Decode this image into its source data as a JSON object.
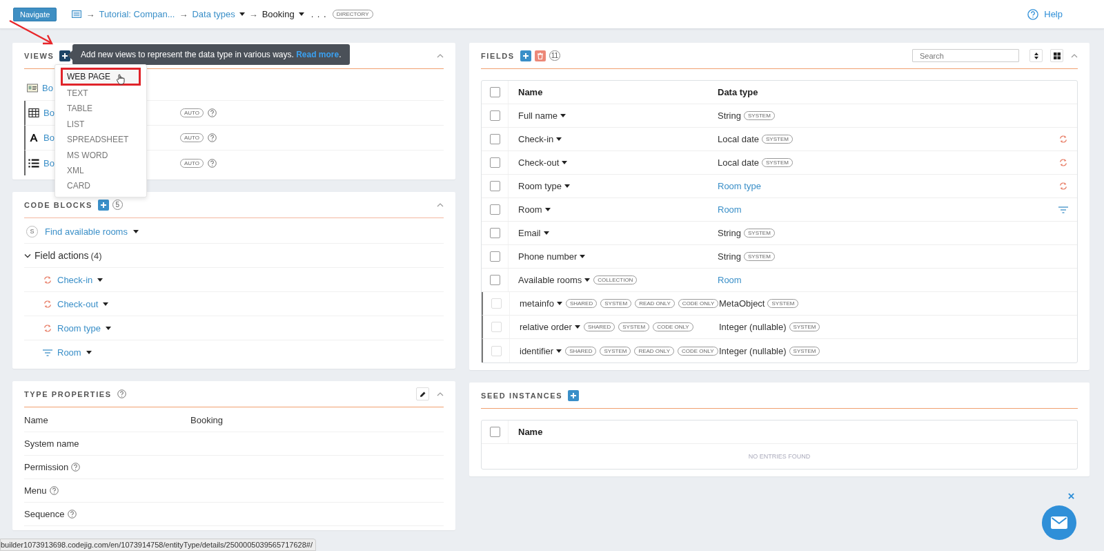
{
  "topbar": {
    "navigate": "Navigate",
    "breadcrumb": [
      {
        "sep": "→",
        "text": "Tutorial: Compan...",
        "link": true,
        "caret": false
      },
      {
        "sep": "→",
        "text": "Data types",
        "link": true,
        "caret": true
      },
      {
        "sep": "→",
        "text": "Booking",
        "link": false,
        "caret": true
      }
    ],
    "ellipsis": ". . .",
    "badge": "DIRECTORY",
    "help": "Help"
  },
  "views": {
    "title": "VIEWS",
    "tooltip": {
      "text": "Add new views to represent the data type in various ways.",
      "link": "Read more",
      "end": "."
    },
    "menu": [
      {
        "label": "WEB PAGE",
        "selected": true
      },
      {
        "label": "TEXT",
        "selected": false
      },
      {
        "label": "TABLE",
        "selected": false
      },
      {
        "label": "LIST",
        "selected": false
      },
      {
        "label": "SPREADSHEET",
        "selected": false
      },
      {
        "label": "MS WORD",
        "selected": false
      },
      {
        "label": "XML",
        "selected": false
      },
      {
        "label": "CARD",
        "selected": false
      }
    ],
    "rows": [
      {
        "kind": "card",
        "name": "Bo",
        "chips": [],
        "help": false,
        "accent": false
      },
      {
        "kind": "table",
        "name": "Bo",
        "chips": [
          "AUTO"
        ],
        "help": true,
        "accent": true
      },
      {
        "kind": "text",
        "name": "Bo",
        "chips": [
          "AUTO"
        ],
        "help": true,
        "accent": true
      },
      {
        "kind": "list",
        "name": "Bo",
        "chips": [
          "AUTO"
        ],
        "help": true,
        "accent": true
      }
    ]
  },
  "code_blocks": {
    "title": "CODE BLOCKS",
    "count": "5",
    "items": [
      {
        "kind": "item",
        "badge": "S",
        "label": "Find available rooms"
      },
      {
        "kind": "group",
        "label": "Field actions",
        "count": "(4)",
        "expanded": true,
        "children": [
          {
            "kind": "sync",
            "label": "Check-in"
          },
          {
            "kind": "sync",
            "label": "Check-out"
          },
          {
            "kind": "sync",
            "label": "Room type"
          },
          {
            "kind": "filter",
            "label": "Room"
          }
        ]
      }
    ]
  },
  "type_properties": {
    "title": "TYPE PROPERTIES",
    "rows": [
      {
        "label": "Name",
        "value": "Booking",
        "help": false
      },
      {
        "label": "System name",
        "help": false
      },
      {
        "label": "Permission",
        "help": true
      },
      {
        "label": "Menu",
        "help": true
      },
      {
        "label": "Sequence",
        "help": true
      }
    ]
  },
  "fields": {
    "title": "FIELDS",
    "count": "11",
    "search": {
      "placeholder": "Search"
    },
    "select_all": {
      "checked": false
    },
    "columns": [
      "Name",
      "Data type"
    ],
    "rows": [
      {
        "kind": "plain",
        "name": "Full name",
        "chips": [],
        "type": "String",
        "type_link": false,
        "type_chips": [
          "SYSTEM"
        ],
        "system": false
      },
      {
        "kind": "sync",
        "name": "Check-in",
        "chips": [],
        "type": "Local date",
        "type_link": false,
        "type_chips": [
          "SYSTEM"
        ],
        "system": false
      },
      {
        "kind": "sync",
        "name": "Check-out",
        "chips": [],
        "type": "Local date",
        "type_link": false,
        "type_chips": [
          "SYSTEM"
        ],
        "system": false
      },
      {
        "kind": "sync",
        "name": "Room type",
        "chips": [],
        "type": "Room type",
        "type_link": true,
        "type_chips": [],
        "system": false
      },
      {
        "kind": "filter",
        "name": "Room",
        "chips": [],
        "type": "Room",
        "type_link": true,
        "type_chips": [],
        "system": false
      },
      {
        "kind": "plain",
        "name": "Email",
        "chips": [],
        "type": "String",
        "type_link": false,
        "type_chips": [
          "SYSTEM"
        ],
        "system": false
      },
      {
        "kind": "plain",
        "name": "Phone number",
        "chips": [],
        "type": "String",
        "type_link": false,
        "type_chips": [
          "SYSTEM"
        ],
        "system": false
      },
      {
        "kind": "plain",
        "name": "Available rooms",
        "chips": [
          "COLLECTION"
        ],
        "type": "Room",
        "type_link": true,
        "type_chips": [],
        "system": false
      },
      {
        "kind": "plain",
        "name": "metainfo",
        "chips": [
          "SHARED",
          "SYSTEM",
          "READ ONLY",
          "CODE ONLY"
        ],
        "type": "MetaObject",
        "type_link": false,
        "type_chips": [
          "SYSTEM"
        ],
        "system": true
      },
      {
        "kind": "plain",
        "name": "relative order",
        "chips": [
          "SHARED",
          "SYSTEM",
          "CODE ONLY"
        ],
        "type": "Integer (nullable)",
        "type_link": false,
        "type_chips": [
          "SYSTEM"
        ],
        "system": true
      },
      {
        "kind": "plain",
        "name": "identifier",
        "chips": [
          "SHARED",
          "SYSTEM",
          "READ ONLY",
          "CODE ONLY"
        ],
        "type": "Integer (nullable)",
        "type_link": false,
        "type_chips": [
          "SYSTEM"
        ],
        "system": true
      }
    ]
  },
  "seed_instances": {
    "title": "SEED INSTANCES",
    "select_all": {
      "checked": false
    },
    "columns": [
      "Name"
    ],
    "empty": "NO ENTRIES FOUND"
  },
  "status_bar": {
    "url": "builder1073913698.codejig.com/en/1073914758/entityType/details/2500005039565717628#/"
  }
}
